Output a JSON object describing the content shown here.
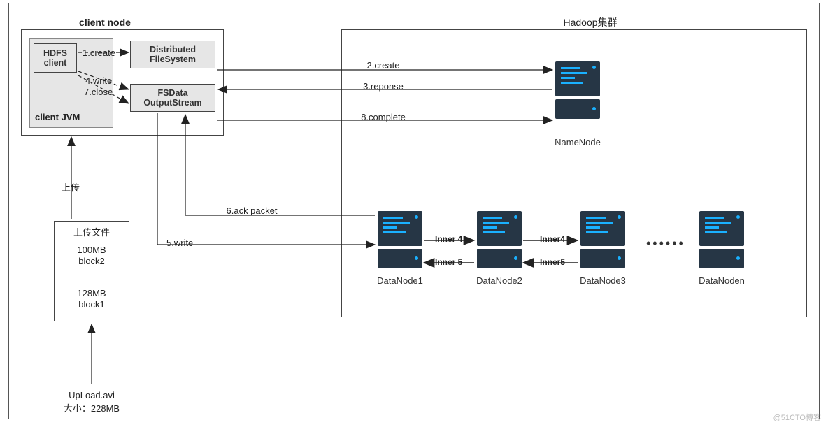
{
  "clientNode": {
    "title": "client node",
    "jvmLabel": "client JVM",
    "hdfsClient": "HDFS\nclient",
    "distributedFS": "Distributed\nFileSystem",
    "fsDataOut": "FSData\nOutputStream"
  },
  "edges": {
    "e1": "1.create",
    "e4": "4.write",
    "e7": "7.close",
    "e2": "2.create",
    "e3": "3.reponse",
    "e8": "8.complete",
    "e5": "5.write",
    "e6": "6.ack packet",
    "inner4a": "Inner 4",
    "inner5a": "Inner 5",
    "inner4b": "Inner4",
    "inner5b": "Inner5"
  },
  "uploadLabel": "上传",
  "uploadFileTitle": "上传文件",
  "block2": {
    "size": "100MB",
    "name": "block2"
  },
  "block1": {
    "size": "128MB",
    "name": "block1"
  },
  "uploadFile": {
    "name": "UpLoad.avi",
    "size": "大小：228MB"
  },
  "hadoop": {
    "title": "Hadoop集群",
    "namenode": "NameNode",
    "datanode1": "DataNode1",
    "datanode2": "DataNode2",
    "datanode3": "DataNode3",
    "datanoden": "DataNoden",
    "ellipsis": "••••••"
  },
  "watermark": "@51CTO博客",
  "chart_data": {
    "type": "flow-diagram",
    "nodes": [
      {
        "id": "hdfs_client",
        "label": "HDFS client",
        "group": "client JVM"
      },
      {
        "id": "distributed_fs",
        "label": "Distributed FileSystem",
        "group": "client node"
      },
      {
        "id": "fsdata_out",
        "label": "FSData OutputStream",
        "group": "client node"
      },
      {
        "id": "namenode",
        "label": "NameNode",
        "group": "Hadoop集群"
      },
      {
        "id": "datanode1",
        "label": "DataNode1",
        "group": "Hadoop集群"
      },
      {
        "id": "datanode2",
        "label": "DataNode2",
        "group": "Hadoop集群"
      },
      {
        "id": "datanode3",
        "label": "DataNode3",
        "group": "Hadoop集群"
      },
      {
        "id": "datanoden",
        "label": "DataNoden",
        "group": "Hadoop集群"
      },
      {
        "id": "upload_file",
        "label": "UpLoad.avi 228MB"
      },
      {
        "id": "block1",
        "label": "block1 128MB"
      },
      {
        "id": "block2",
        "label": "block2 100MB"
      }
    ],
    "edges": [
      {
        "from": "hdfs_client",
        "to": "distributed_fs",
        "label": "1.create",
        "style": "dashed"
      },
      {
        "from": "distributed_fs",
        "to": "namenode",
        "label": "2.create"
      },
      {
        "from": "namenode",
        "to": "fsdata_out",
        "label": "3.reponse"
      },
      {
        "from": "hdfs_client",
        "to": "fsdata_out",
        "label": "4.write",
        "style": "dashed"
      },
      {
        "from": "fsdata_out",
        "to": "datanode1",
        "label": "5.write"
      },
      {
        "from": "datanode1",
        "to": "fsdata_out",
        "label": "6.ack packet"
      },
      {
        "from": "hdfs_client",
        "to": "fsdata_out",
        "label": "7.close",
        "style": "dashed"
      },
      {
        "from": "fsdata_out",
        "to": "namenode",
        "label": "8.complete"
      },
      {
        "from": "datanode1",
        "to": "datanode2",
        "label": "Inner 4"
      },
      {
        "from": "datanode2",
        "to": "datanode1",
        "label": "Inner 5"
      },
      {
        "from": "datanode2",
        "to": "datanode3",
        "label": "Inner4"
      },
      {
        "from": "datanode3",
        "to": "datanode2",
        "label": "Inner5"
      },
      {
        "from": "upload_file",
        "to": "block1",
        "label": "上传"
      }
    ]
  }
}
